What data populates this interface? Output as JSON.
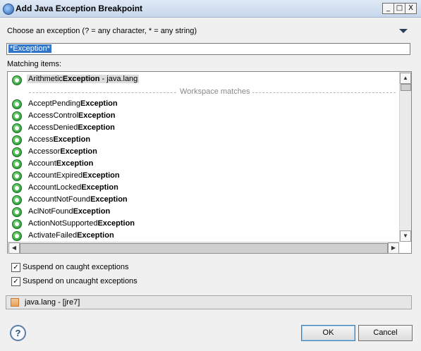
{
  "window": {
    "title": "Add Java Exception Breakpoint",
    "buttons": [
      "_",
      "□",
      "X"
    ]
  },
  "prompt": "Choose an exception (? = any character, * = any string)",
  "filter": {
    "value": "*Exception*"
  },
  "matching_label": "Matching items:",
  "history_item": {
    "prefix": "Arithmetic",
    "bold": "Exception",
    "suffix": " - java.lang"
  },
  "separator": "Workspace matches",
  "items": [
    {
      "prefix": "AcceptPending",
      "bold": "Exception"
    },
    {
      "prefix": "AccessControl",
      "bold": "Exception"
    },
    {
      "prefix": "AccessDenied",
      "bold": "Exception"
    },
    {
      "prefix": "Access",
      "bold": "Exception"
    },
    {
      "prefix": "Accessor",
      "bold": "Exception"
    },
    {
      "prefix": "Account",
      "bold": "Exception"
    },
    {
      "prefix": "AccountExpired",
      "bold": "Exception"
    },
    {
      "prefix": "AccountLocked",
      "bold": "Exception"
    },
    {
      "prefix": "AccountNotFound",
      "bold": "Exception"
    },
    {
      "prefix": "AclNotFound",
      "bold": "Exception"
    },
    {
      "prefix": "ActionNotSupported",
      "bold": "Exception"
    },
    {
      "prefix": "ActivateFailed",
      "bold": "Exception"
    }
  ],
  "options": {
    "caught": {
      "label": "Suspend on caught exceptions",
      "checked": true,
      "mark": "✓"
    },
    "uncaught": {
      "label": "Suspend on uncaught exceptions",
      "checked": true,
      "mark": "✓"
    }
  },
  "package": "java.lang - [jre7]",
  "buttons": {
    "help": "?",
    "ok": "OK",
    "cancel": "Cancel"
  },
  "colors": {
    "accent": "#3277c7",
    "titlebar": "#c7d7ec"
  }
}
